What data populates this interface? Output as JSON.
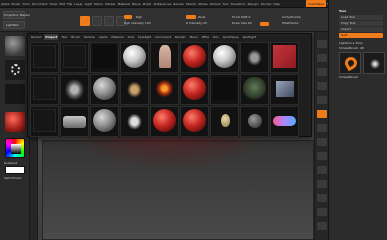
{
  "menubar": {
    "items": [
      "Alpha",
      "Brush",
      "Color",
      "Document",
      "Draw",
      "Edit",
      "File",
      "Layer",
      "Light",
      "Macro",
      "Marker",
      "Material",
      "Movie",
      "Picker",
      "Preferences",
      "Render",
      "Stencil",
      "Stroke",
      "Texture",
      "Tool",
      "Transform",
      "Zplugin",
      "Zscript",
      "Help"
    ],
    "highlight": "QuickSave",
    "see_through": "See-through 0",
    "menus": "Menus",
    "script": "DefaultZScript"
  },
  "toolbar": {
    "projection": "Projection Master",
    "lightbox": "LightBox",
    "edit": "Edit",
    "draw": "Draw",
    "move": "Move",
    "scale": "Scale",
    "rotate": "Rotate",
    "mrgb": "Mrgb",
    "rgb": "Rgb",
    "m": "M",
    "zadd": "Zadd",
    "zsub": "Zsub",
    "zcut": "Zcut",
    "rgb_intensity": "Rgb Intensity 100",
    "z_intensity": "Z Intensity 25",
    "focal_shift": "Focal Shift 0",
    "draw_size": "Draw Size 64",
    "dynamic": "Dynamic",
    "active_points": "ActivePoints:",
    "total_points": "TotalPoints:"
  },
  "popup": {
    "tabs": [
      "Recent",
      "Project",
      "Tool",
      "Brush",
      "Texture",
      "Alpha",
      "Material",
      "Grid",
      "Spotlight",
      "Document",
      "Render",
      "Menu",
      "ZFile",
      "Doc",
      "QuickSave",
      "Spotlight"
    ],
    "active_tab": "Project",
    "thumbs": [
      {
        "label": "",
        "kind": "blank"
      },
      {
        "label": "",
        "kind": "blank"
      },
      {
        "label": "",
        "kind": "dark"
      },
      {
        "label": "",
        "kind": "white-sphere"
      },
      {
        "label": "",
        "kind": "figure"
      },
      {
        "label": "",
        "kind": "red-sphere"
      },
      {
        "label": "",
        "kind": "white-sphere"
      },
      {
        "label": "",
        "kind": "horse"
      },
      {
        "label": "",
        "kind": "red-square"
      },
      {
        "label": "",
        "kind": "blank"
      },
      {
        "label": "",
        "kind": "mech"
      },
      {
        "label": "",
        "kind": "gray-sphere"
      },
      {
        "label": "",
        "kind": "horse-gold"
      },
      {
        "label": "",
        "kind": "fire-figure"
      },
      {
        "label": "",
        "kind": "red-sphere"
      },
      {
        "label": "",
        "kind": "dark"
      },
      {
        "label": "",
        "kind": "green-creature"
      },
      {
        "label": "",
        "kind": "box"
      },
      {
        "label": "",
        "kind": "blank"
      },
      {
        "label": "",
        "kind": "car"
      },
      {
        "label": "",
        "kind": "gray-sphere"
      },
      {
        "label": "",
        "kind": "horse-white"
      },
      {
        "label": "",
        "kind": "red-sphere"
      },
      {
        "label": "",
        "kind": "red-sphere"
      },
      {
        "label": "",
        "kind": "egg"
      },
      {
        "label": "",
        "kind": "small-sphere"
      },
      {
        "label": "",
        "kind": "capsule"
      }
    ]
  },
  "left": {
    "gradient_label": "Gradient",
    "switch_label": "SwitchColor",
    "alternate_label": "Alternate"
  },
  "rightpanel": {
    "title": "Tool",
    "load_tool": "Load Tool",
    "save_as": "Save As",
    "copy_tool": "Copy Tool",
    "paste_tool": "Paste Tool",
    "import": "Import",
    "export": "Export",
    "goz": "GoZ",
    "all": "All",
    "visible": "Visible",
    "r": "R",
    "lightbox_tools": "Lightbox ▸ Tools",
    "current": "SimpleBrush: 48",
    "r_label": "R",
    "brush_name": "SimpleBrush"
  },
  "colors": {
    "accent": "#f07b1a",
    "primary": "#b8231f",
    "bg": "#2b2b2b"
  }
}
